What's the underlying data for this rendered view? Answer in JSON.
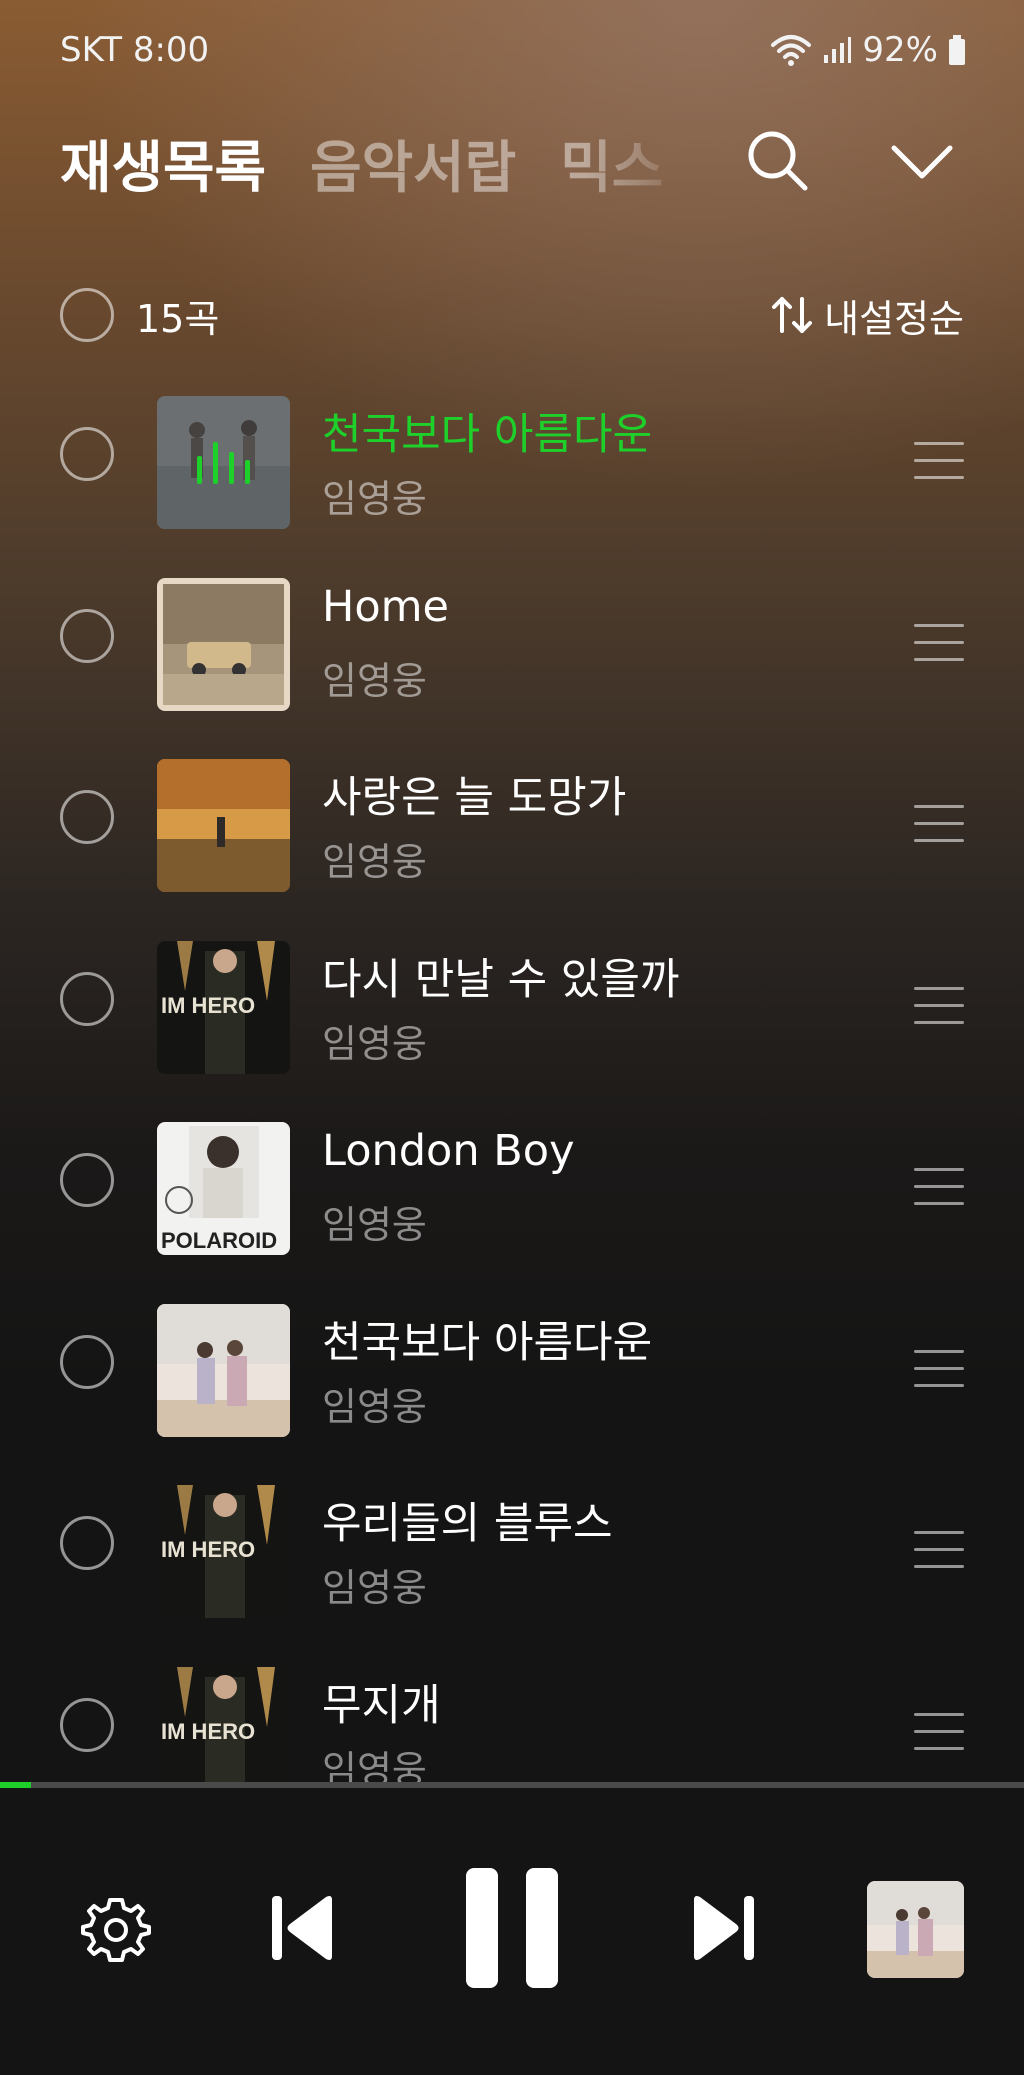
{
  "status_bar": {
    "carrier": "SKT",
    "time": "8:00",
    "battery": "92%"
  },
  "tabs": [
    {
      "label": "재생목록",
      "active": true
    },
    {
      "label": "음악서랍",
      "active": false
    },
    {
      "label": "믹스",
      "active": false
    }
  ],
  "list_header": {
    "count": "15곡",
    "sort_label": "내설정순"
  },
  "tracks": [
    {
      "title": "천국보다 아름다운",
      "artist": "임영웅",
      "playing": true
    },
    {
      "title": "Home",
      "artist": "임영웅",
      "playing": false
    },
    {
      "title": "사랑은 늘 도망가",
      "artist": "임영웅",
      "playing": false
    },
    {
      "title": "다시 만날 수 있을까",
      "artist": "임영웅",
      "playing": false
    },
    {
      "title": "London Boy",
      "artist": "임영웅",
      "playing": false
    },
    {
      "title": "천국보다 아름다운",
      "artist": "임영웅",
      "playing": false
    },
    {
      "title": "우리들의 블루스",
      "artist": "임영웅",
      "playing": false
    },
    {
      "title": "무지개",
      "artist": "임영웅",
      "playing": false
    }
  ],
  "album_art_text": {
    "im_hero": "IM HERO",
    "polaroid": "POLAROID"
  },
  "player": {
    "progress": 0.03,
    "state": "playing"
  },
  "colors": {
    "accent_green": "#1ed12a",
    "background": "#141414",
    "top_gradient": "#8a5c33"
  },
  "icons": [
    "wifi-icon",
    "signal-icon",
    "battery-icon",
    "search-icon",
    "chevron-down-icon",
    "sort-icon",
    "drag-handle-icon",
    "settings-icon",
    "previous-icon",
    "pause-icon",
    "next-icon",
    "equalizer-icon"
  ]
}
